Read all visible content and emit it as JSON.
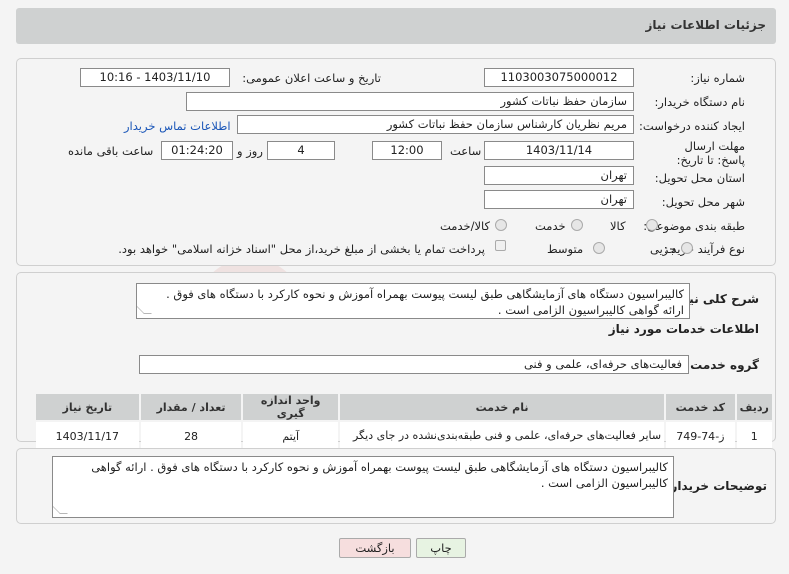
{
  "header": {
    "title": "جزئیات اطلاعات نیاز"
  },
  "info": {
    "need_number_label": "شماره نیاز:",
    "need_number": "1103003075000012",
    "announce_label": "تاریخ و ساعت اعلان عمومی:",
    "announce_value": "1403/11/10 - 10:16",
    "buyer_org_label": "نام دستگاه خریدار:",
    "buyer_org": "سازمان حفظ نباتات کشور",
    "requester_label": "ایجاد کننده درخواست:",
    "requester": "مریم نظریان کارشناس سازمان حفظ نباتات کشور",
    "contact_link": "اطلاعات تماس خریدار",
    "deadline_label": "مهلت ارسال پاسخ: تا تاریخ:",
    "deadline_date": "1403/11/14",
    "time_label": "ساعت",
    "deadline_time": "12:00",
    "days_value": "4",
    "days_label": "روز و",
    "remaining_time": "01:24:20",
    "remaining_label": "ساعت باقی مانده",
    "province_label": "استان محل تحویل:",
    "province": "تهران",
    "city_label": "شهر محل تحویل:",
    "city": "تهران",
    "category_label": "طبقه بندی موضوعی:",
    "category_options": [
      "کالا",
      "خدمت",
      "کالا/خدمت"
    ],
    "process_label": "نوع فرآیند خرید :",
    "process_options": [
      "جزیی",
      "متوسط"
    ],
    "payment_note": "پرداخت تمام یا بخشی از مبلغ خرید،از محل \"اسناد خزانه اسلامی\" خواهد بود."
  },
  "summary": {
    "label": "شرح کلی نیاز:",
    "text": "کالیبراسیون دستگاه های آزمایشگاهی طبق لیست پیوست بهمراه آموزش و نحوه کارکرد با دستگاه های فوق . ارائه گواهی کالیبراسیون الزامی است ."
  },
  "services": {
    "section_title": "اطلاعات خدمات مورد نیاز",
    "group_label": "گروه خدمت:",
    "group_value": "فعالیت‌های حرفه‌ای، علمی و فنی",
    "columns": [
      "ردیف",
      "کد خدمت",
      "نام خدمت",
      "واحد اندازه گیری",
      "تعداد / مقدار",
      "تاریخ نیاز"
    ],
    "rows": [
      {
        "row": "1",
        "code": "ز-74-749",
        "name": "سایر فعالیت‌های حرفه‌ای، علمی و فنی طبقه‌بندی‌نشده در جای دیگر",
        "unit": "آیتم",
        "qty": "28",
        "date": "1403/11/17"
      }
    ]
  },
  "buyer_notes": {
    "label": "توضیحات خریدار:",
    "text": "کالیبراسیون دستگاه های آزمایشگاهی طبق لیست پیوست بهمراه آموزش و نحوه کارکرد با دستگاه های فوق . ارائه گواهی کالیبراسیون الزامی است ."
  },
  "buttons": {
    "print": "چاپ",
    "back": "بازگشت"
  },
  "colors": {
    "header_bg": "#cfd1d1",
    "link": "#1a56b8",
    "back_btn_bg": "#f6dede",
    "print_btn_bg": "#e7f3e2"
  },
  "watermark": {
    "text": "AriaTender.neT"
  }
}
